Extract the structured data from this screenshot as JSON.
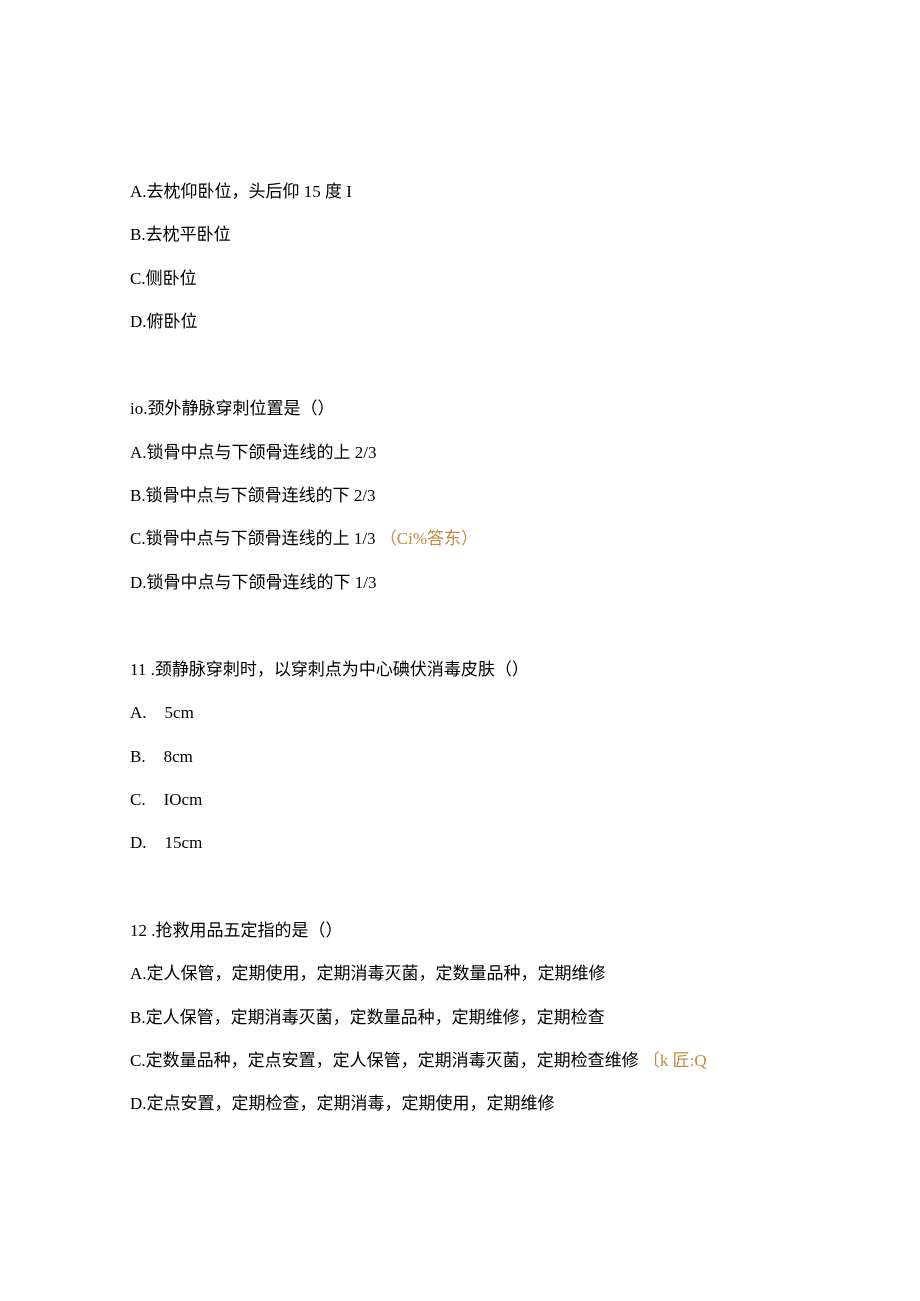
{
  "q9": {
    "A": "A.去枕仰卧位，头后仰 15 度 I",
    "B": "B.去枕平卧位",
    "C": "C.侧卧位",
    "D": "D.俯卧位"
  },
  "q10": {
    "stem": "io.颈外静脉穿刺位置是（）",
    "A": "A.锁骨中点与下颌骨连线的上 2/3",
    "B": "B.锁骨中点与下颌骨连线的下 2/3",
    "C_text": "C.锁骨中点与下颌骨连线的上 1/3",
    "C_annot": "（Ci%答东）",
    "D": "D.锁骨中点与下颌骨连线的下 1/3"
  },
  "q11": {
    "stem": "11   .颈静脉穿刺时，以穿刺点为中心碘伏消毒皮肤（）",
    "A_label": "A.",
    "A_val": "5cm",
    "B_label": "B.",
    "B_val": "8cm",
    "C_label": "C.",
    "C_val": "IOcm",
    "D_label": "D.",
    "D_val": "15cm"
  },
  "q12": {
    "stem": "12   .抢救用品五定指的是（）",
    "A": "A.定人保管，定期使用，定期消毒灭菌，定数量品种，定期维修",
    "B": "B.定人保管，定期消毒灭菌，定数量品种，定期维修，定期检查",
    "C_text": "C.定数量品种，定点安置，定人保管，定期消毒灭菌，定期检查维修",
    "C_annot": "〔k 匠:Q",
    "D": "D.定点安置，定期检查，定期消毒，定期使用，定期维修"
  }
}
